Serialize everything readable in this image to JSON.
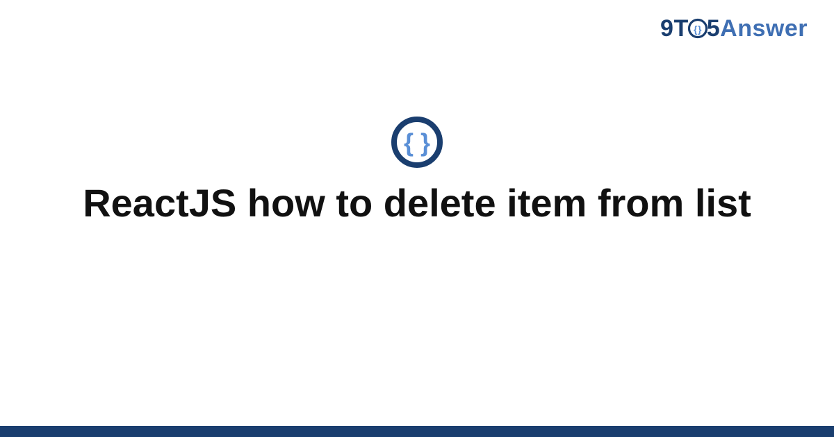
{
  "brand": {
    "nine": "9",
    "t": "T",
    "five": "5",
    "answer": "Answer"
  },
  "title": "ReactJS how to delete item from list",
  "colors": {
    "brand_dark": "#1a3e6f",
    "brand_light": "#3f6fb3",
    "glyph_fill": "#5a8fd6"
  }
}
